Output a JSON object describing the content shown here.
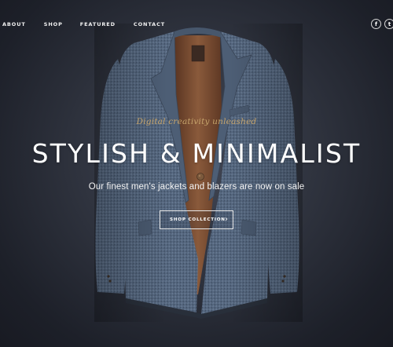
{
  "nav": {
    "items": [
      {
        "label": "ABOUT"
      },
      {
        "label": "SHOP"
      },
      {
        "label": "FEATURED"
      },
      {
        "label": "CONTACT"
      }
    ]
  },
  "social": {
    "facebook": {
      "icon": "facebook-icon",
      "glyph": "f"
    },
    "twitter": {
      "icon": "twitter-icon",
      "glyph": "t"
    }
  },
  "hero": {
    "tagline": "Digital creativity unleashed",
    "headline": "STYLISH & MINIMALIST",
    "subline": "Our finest men's jackets and blazers are now on sale",
    "cta_label": "SHOP COLLECTION",
    "cta_arrow": "›"
  },
  "colors": {
    "background": "#2e323d",
    "accent_gold": "#c7a56c",
    "jacket_blue": "#55677f",
    "lining_brown": "#7a4f33"
  }
}
